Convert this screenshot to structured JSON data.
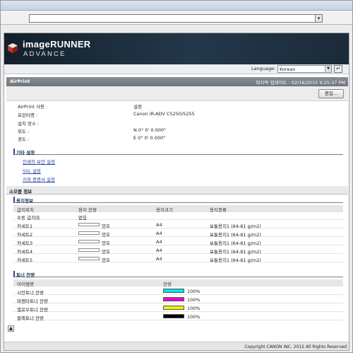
{
  "browser": {
    "address_value": "",
    "address_dropdown_icon": "down-arrow-icon"
  },
  "header": {
    "brand_line1": "imageRUNNER",
    "brand_line2": "ADVANCE",
    "language_label": "Language:",
    "language_value": "Korean"
  },
  "section": {
    "title": "AirPrint",
    "last_updated": "마지막 업데이트 : 02/16/2015 9:25:37 PM",
    "edit_button": "편집..."
  },
  "airprint_info": [
    {
      "key": "AirPrint 사용 :",
      "value": "설정"
    },
    {
      "key": "프린터명 :",
      "value": "Canon iR-ADV C5250/5255"
    },
    {
      "key": "설치 장소 :",
      "value": ""
    },
    {
      "key": "위도 :",
      "value": "N 0° 0' 0.000\""
    },
    {
      "key": "경도 :",
      "value": "E 0° 0' 0.000\""
    }
  ],
  "other_settings": {
    "title": "기타 설정",
    "links": [
      "인쇄의 보안 설정",
      "SSL 설정",
      "키와 증명서 설정"
    ]
  },
  "consumables": {
    "title": "소모품 정보"
  },
  "paper": {
    "title": "용지정보",
    "headers": [
      "급지위치",
      "용지 잔량",
      "용지크기",
      "용지종류"
    ],
    "rows": [
      {
        "source": "수동 급지대",
        "remain": "없음",
        "level": null,
        "size": "",
        "type": ""
      },
      {
        "source": "카세트1",
        "remain": "양호",
        "level": 1,
        "size": "A4",
        "type": "보통용지1 (64-81 g/m2)"
      },
      {
        "source": "카세트2",
        "remain": "양호",
        "level": 1,
        "size": "A4",
        "type": "보통용지1 (64-81 g/m2)"
      },
      {
        "source": "카세트3",
        "remain": "양호",
        "level": 1,
        "size": "A4",
        "type": "보통용지1 (64-81 g/m2)"
      },
      {
        "source": "카세트4",
        "remain": "양호",
        "level": 1,
        "size": "A4",
        "type": "보통용지1 (64-81 g/m2)"
      },
      {
        "source": "카세트5",
        "remain": "양호",
        "level": 1,
        "size": "A4",
        "type": "보통용지1 (64-81 g/m2)"
      }
    ]
  },
  "toner": {
    "title": "토너 잔량",
    "headers": [
      "아이템명",
      "잔량"
    ],
    "rows": [
      {
        "name": "시안토너 잔량",
        "percent": "100%",
        "color": "#00e5f2",
        "level": 1
      },
      {
        "name": "마젠타토너 잔량",
        "percent": "100%",
        "color": "#ee00c8",
        "level": 1
      },
      {
        "name": "옐로우토너 잔량",
        "percent": "100%",
        "color": "#f4f000",
        "level": 1
      },
      {
        "name": "블랙토너 잔량",
        "percent": "100%",
        "color": "#000000",
        "level": 1
      }
    ]
  },
  "footer": {
    "copyright": "Copyright CANON INC. 2012 All Rights Reserved",
    "top_icon": "page-top-icon"
  }
}
